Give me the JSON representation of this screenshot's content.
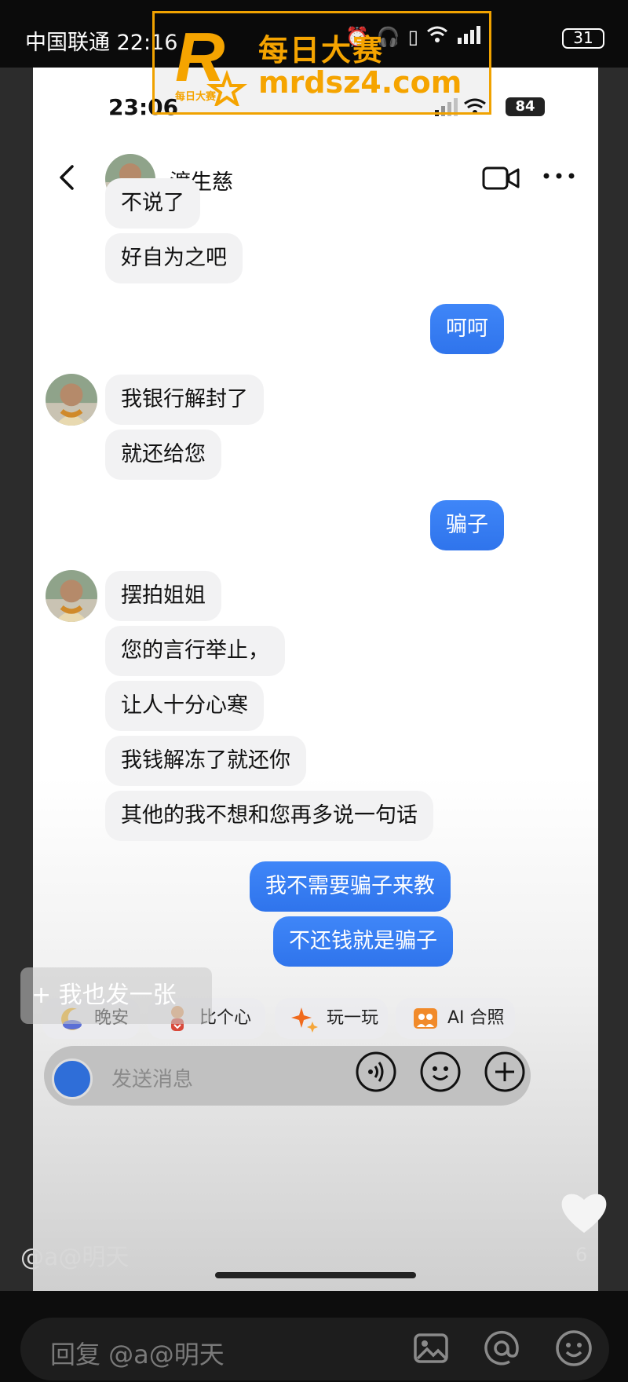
{
  "outer_status": {
    "carrier_time": "中国联通 22:16",
    "battery": "31"
  },
  "inner_status": {
    "time": "23:06",
    "battery": "84"
  },
  "header": {
    "contact_name": "渡生慈"
  },
  "messages": [
    {
      "side": "in",
      "text": "不说了"
    },
    {
      "side": "in",
      "text": "好自为之吧"
    },
    {
      "side": "out",
      "text": "呵呵"
    },
    {
      "side": "in",
      "text": "我银行解封了"
    },
    {
      "side": "in",
      "text": "就还给您"
    },
    {
      "side": "out",
      "text": "骗子"
    },
    {
      "side": "in",
      "text": "摆拍姐姐"
    },
    {
      "side": "in",
      "text": "您的言行举止，"
    },
    {
      "side": "in",
      "text": "让人十分心寒"
    },
    {
      "side": "in",
      "text": "我钱解冻了就还你"
    },
    {
      "side": "in",
      "text": "其他的我不想和您再多说一句话"
    },
    {
      "side": "out",
      "text": "我不需要骗子来教"
    },
    {
      "side": "out",
      "text": "不还钱就是骗子"
    }
  ],
  "quick_actions": [
    {
      "label": "晚安",
      "icon": "moon-icon"
    },
    {
      "label": "比个心",
      "icon": "heart-gesture-icon"
    },
    {
      "label": "玩一玩",
      "icon": "sparkle-icon"
    },
    {
      "label": "AI 合照",
      "icon": "photo-icon"
    }
  ],
  "composer": {
    "placeholder": "发送消息"
  },
  "post_overlay": {
    "label": "+ 我也发一张"
  },
  "handle": "@a@明天",
  "likes": "6",
  "reply": {
    "placeholder": "回复 @a@明天"
  },
  "watermark": {
    "title": "每日大赛",
    "domain": "mrdsz4.com",
    "logo_letter": "R",
    "logo_sub": "每日大赛"
  },
  "colors": {
    "outgoing_bubble": "#3b82f6",
    "incoming_bubble": "#f2f2f3",
    "watermark": "#f5a400"
  }
}
